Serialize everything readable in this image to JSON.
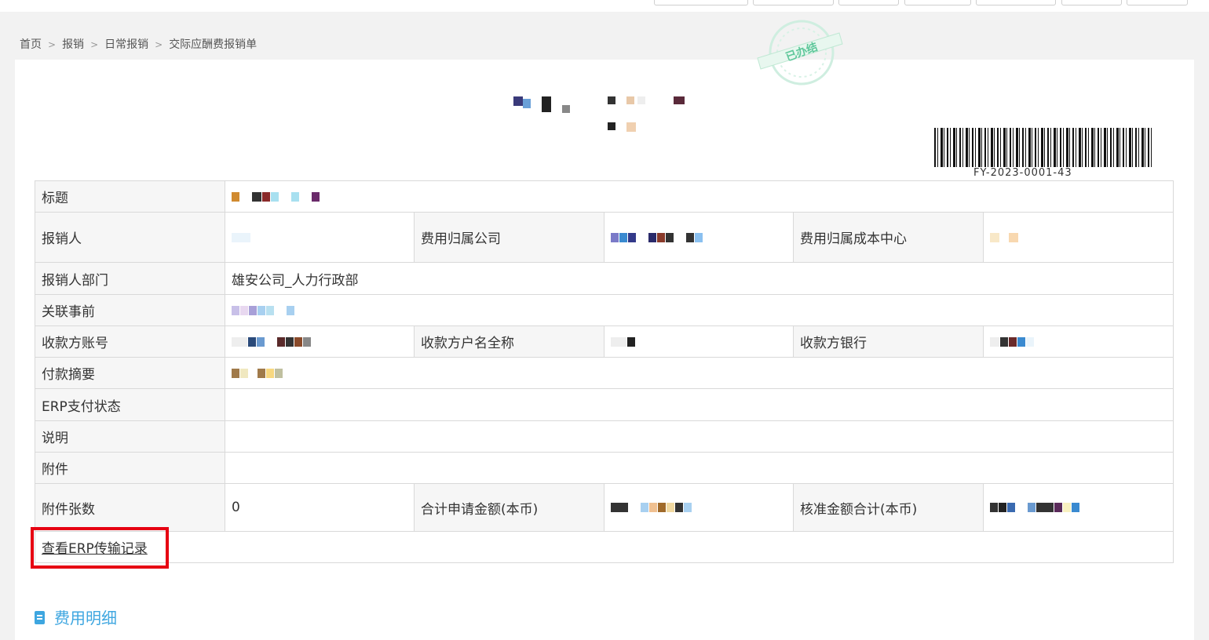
{
  "breadcrumb": {
    "home": "首页",
    "sep": ">",
    "level1": "报销",
    "level2": "日常报销",
    "level3": "交际应酬费报销单"
  },
  "stamp": {
    "text": "已办结"
  },
  "barcode": {
    "number": "FY-2023-0001-43"
  },
  "form": {
    "title_label": "标题",
    "applicant_label": "报销人",
    "expense_company_label": "费用归属公司",
    "cost_center_label": "费用归属成本中心",
    "dept_label": "报销人部门",
    "dept_value": "雄安公司_人力行政部",
    "related_label": "关联事前",
    "account_label": "收款方账号",
    "account_name_label": "收款方户名全称",
    "bank_label": "收款方银行",
    "summary_label": "付款摘要",
    "erp_status_label": "ERP支付状态",
    "note_label": "说明",
    "attach_label": "附件",
    "attach_count_label": "附件张数",
    "attach_count_value": "0",
    "total_apply_label": "合计申请金额(本币)",
    "total_approved_label": "核准金额合计(本币)",
    "erp_link": "查看ERP传输记录"
  },
  "section": {
    "title": "费用明细"
  },
  "colors": {
    "accent": "#3ea6e0",
    "highlight": "#e60012",
    "stamp": "#5ec79a"
  },
  "icons": {
    "section_icon": "document-icon"
  }
}
